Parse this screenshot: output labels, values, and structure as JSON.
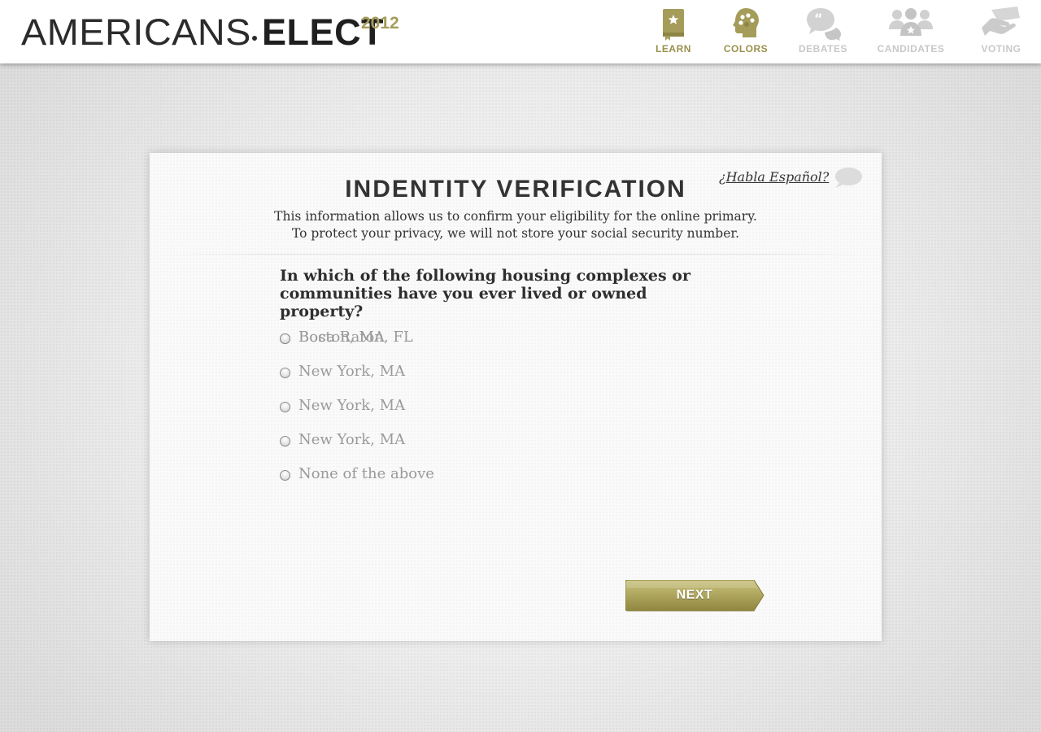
{
  "header": {
    "logo": {
      "word1": "AMERICANS",
      "word2": "ELECT",
      "year": "2012"
    },
    "nav": [
      {
        "label": "LEARN",
        "icon": "book-star-icon",
        "active": true
      },
      {
        "label": "COLORS",
        "icon": "head-palette-icon",
        "active": true
      },
      {
        "label": "DEBATES",
        "icon": "speech-bubbles-icon",
        "active": false
      },
      {
        "label": "CANDIDATES",
        "icon": "people-star-icon",
        "active": false
      },
      {
        "label": "VOTING",
        "icon": "hand-ballot-icon",
        "active": false
      }
    ]
  },
  "card": {
    "title": "INDENTITY VERIFICATION",
    "subtitle_line1": "This information allows us to confirm your eligibility for the online primary.",
    "subtitle_line2": "To protect your privacy, we will not store your social security number.",
    "language_link": "¿Habla Español?",
    "question": "In which of the following housing complexes or communities have you ever lived or owned property?",
    "options": [
      {
        "label": "Boca Raton, FL",
        "checked": true
      },
      {
        "label": "Boston, MA",
        "checked": false
      },
      {
        "label": "New York, MA",
        "checked": false
      },
      {
        "label": "New York, MA",
        "checked": false
      },
      {
        "label": "New York, MA",
        "checked": false
      },
      {
        "label": "None of the above",
        "checked": false
      }
    ],
    "next_label": "NEXT"
  },
  "colors": {
    "accent_gold": "#a59c5a",
    "nav_inactive": "#c8c8c8",
    "text_dark": "#333333",
    "option_text": "#9a9a9a",
    "radio_selected": "#3a78d6"
  }
}
